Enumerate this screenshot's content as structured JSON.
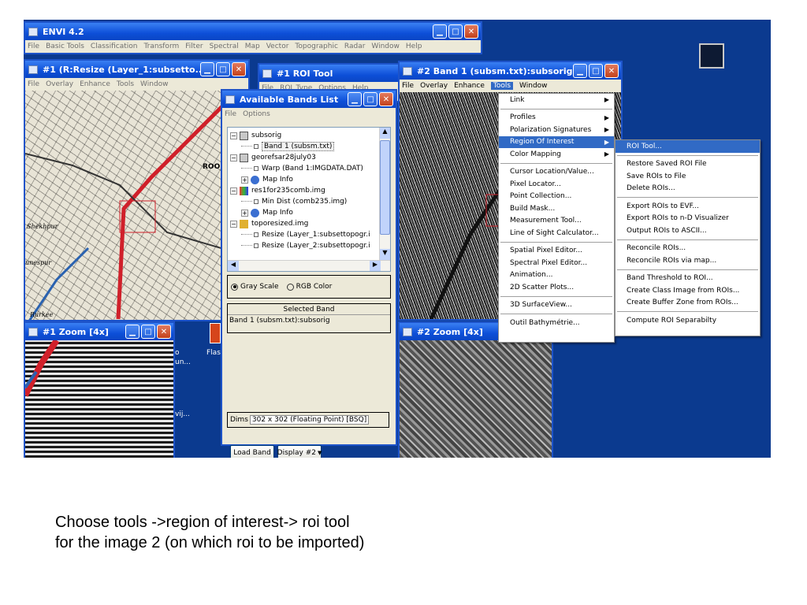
{
  "main_window": {
    "title": "ENVI 4.2",
    "menu": [
      "File",
      "Basic Tools",
      "Classification",
      "Transform",
      "Filter",
      "Spectral",
      "Map",
      "Vector",
      "Topographic",
      "Radar",
      "Window",
      "Help"
    ]
  },
  "display1": {
    "title": "#1 (R:Resize (Layer_1:subsetto...",
    "menu": [
      "File",
      "Overlay",
      "Enhance",
      "Tools",
      "Window"
    ],
    "map_labels": [
      "ROORK",
      "Shekhpur",
      "Rurkee",
      "unespur"
    ]
  },
  "roi_tool": {
    "title": "#1 ROI Tool",
    "menu": [
      "File",
      "ROI_Type",
      "Options",
      "Help"
    ]
  },
  "bands": {
    "title": "Available Bands List",
    "menu": [
      "File",
      "Options"
    ],
    "tree": [
      {
        "label": "subsorig",
        "level": 0,
        "box": "−",
        "icon": "file-icon"
      },
      {
        "label": "Band 1 (subsm.txt)",
        "level": 1,
        "box": "",
        "icon": "band-icon",
        "selected": true
      },
      {
        "label": "georefsar28july03",
        "level": 0,
        "box": "−",
        "icon": "file-icon"
      },
      {
        "label": "Warp (Band 1:IMGDATA.DAT)",
        "level": 1,
        "box": "",
        "icon": "band-icon"
      },
      {
        "label": "Map Info",
        "level": 1,
        "box": "+",
        "icon": "globe-icon"
      },
      {
        "label": "res1for235comb.img",
        "level": 0,
        "box": "−",
        "icon": "color-file-icon"
      },
      {
        "label": "Min Dist (comb235.img)",
        "level": 1,
        "box": "",
        "icon": "band-icon"
      },
      {
        "label": "Map Info",
        "level": 1,
        "box": "+",
        "icon": "globe-icon"
      },
      {
        "label": "toporesized.img",
        "level": 0,
        "box": "−",
        "icon": "layer-icon"
      },
      {
        "label": "Resize (Layer_1:subsettopogr.i",
        "level": 1,
        "box": "",
        "icon": "band-icon"
      },
      {
        "label": "Resize (Layer_2:subsettopogr.i",
        "level": 1,
        "box": "",
        "icon": "band-icon"
      }
    ],
    "radio_gray": "Gray Scale",
    "radio_rgb": "RGB Color",
    "selected_band_label": "Selected Band",
    "selected_band_value": "Band 1 (subsm.txt):subsorig",
    "dims_label": "Dims",
    "dims_value": "302 x 302 (Floating Point) [BSQ]",
    "load_button": "Load Band",
    "display_button": "Display #2"
  },
  "display2": {
    "title": "#2 Band 1 (subsm.txt):subsorig",
    "menu": [
      "File",
      "Overlay",
      "Enhance",
      "Tools",
      "Window"
    ],
    "active_menu": "Tools"
  },
  "zoom1": {
    "title": "#1 Zoom [4x]"
  },
  "zoom2": {
    "title": "#2 Zoom [4x]"
  },
  "desktop_items": [
    "o",
    "un...",
    "Flas",
    "vij..."
  ],
  "tools_menu": [
    {
      "label": "Link",
      "sub": true
    },
    {
      "sep": true
    },
    {
      "label": "Profiles",
      "sub": true
    },
    {
      "label": "Polarization Signatures",
      "sub": true
    },
    {
      "label": "Region Of Interest",
      "sub": true,
      "hl": true
    },
    {
      "label": "Color Mapping",
      "sub": true
    },
    {
      "sep": true
    },
    {
      "label": "Cursor Location/Value..."
    },
    {
      "label": "Pixel Locator..."
    },
    {
      "label": "Point Collection..."
    },
    {
      "label": "Build Mask..."
    },
    {
      "label": "Measurement Tool..."
    },
    {
      "label": "Line of Sight Calculator..."
    },
    {
      "sep": true
    },
    {
      "label": "Spatial Pixel Editor..."
    },
    {
      "label": "Spectral Pixel Editor..."
    },
    {
      "label": "Animation..."
    },
    {
      "label": "2D Scatter Plots..."
    },
    {
      "sep": true
    },
    {
      "label": "3D SurfaceView..."
    },
    {
      "sep": true
    },
    {
      "label": "Outil Bathymétrie..."
    }
  ],
  "roi_submenu": [
    {
      "label": "ROI Tool...",
      "hl": true
    },
    {
      "sep": true
    },
    {
      "label": "Restore Saved ROI File"
    },
    {
      "label": "Save ROIs to File"
    },
    {
      "label": "Delete ROIs..."
    },
    {
      "sep": true
    },
    {
      "label": "Export ROIs to EVF..."
    },
    {
      "label": "Export ROIs to n-D Visualizer"
    },
    {
      "label": "Output ROIs to ASCII..."
    },
    {
      "sep": true
    },
    {
      "label": "Reconcile ROIs..."
    },
    {
      "label": "Reconcile ROIs via map..."
    },
    {
      "sep": true
    },
    {
      "label": "Band Threshold to ROI..."
    },
    {
      "label": "Create Class Image from ROIs..."
    },
    {
      "label": "Create Buffer Zone from ROIs..."
    },
    {
      "sep": true
    },
    {
      "label": "Compute ROI Separabilty"
    }
  ],
  "caption": {
    "line1": "Choose tools ->region of interest-> roi tool",
    "line2": "for the image 2 (on which roi to be imported)"
  },
  "colors": {
    "desktop": "#0b3a8f",
    "titlebar": "#0d4fd8",
    "highlight": "#316ac5",
    "road": "#d0202a"
  }
}
